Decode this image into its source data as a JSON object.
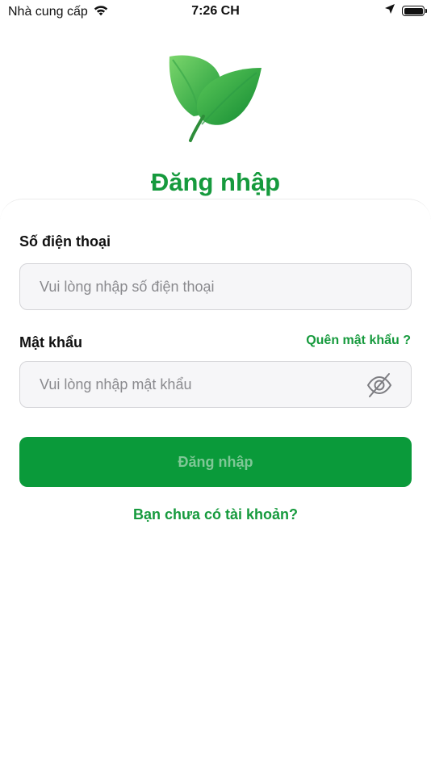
{
  "status_bar": {
    "carrier": "Nhà cung cấp",
    "time": "7:26 CH",
    "icons": [
      "wifi-icon",
      "location-arrow-icon",
      "battery-icon"
    ]
  },
  "logo": {
    "icon": "leaf-logo-icon"
  },
  "page": {
    "title": "Đăng nhập"
  },
  "form": {
    "phone": {
      "label": "Số điện thoại",
      "placeholder": "Vui lòng nhập số điện thoại",
      "value": ""
    },
    "password": {
      "label": "Mật khẩu",
      "placeholder": "Vui lòng nhập mật khẩu",
      "value": "",
      "toggle_icon": "eye-slash-icon"
    },
    "forgot_password": "Quên mật khẩu ?",
    "submit_label": "Đăng nhập",
    "register_link": "Bạn chưa có tài khoản?"
  },
  "colors": {
    "brand_green": "#169a3d",
    "button_green": "#0a9a3a",
    "button_text_disabled": "#7fc796",
    "input_bg": "#f6f6f8",
    "input_border": "#d4d4d8",
    "placeholder": "#8a8a8e"
  }
}
